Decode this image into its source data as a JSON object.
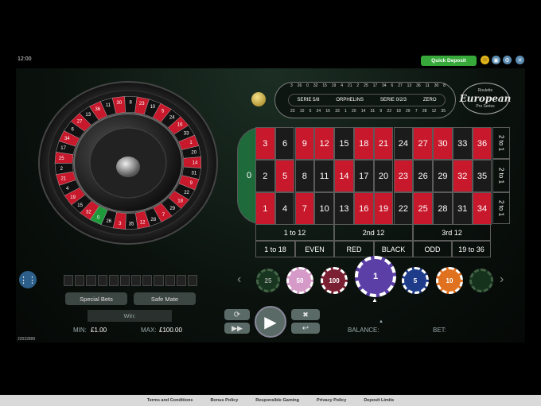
{
  "top": {
    "clock": "12:00",
    "quick_deposit": "Quick Deposit"
  },
  "race": {
    "left_row": [
      "3",
      "26",
      "0",
      "32",
      "15",
      "19",
      "4",
      "21",
      "2",
      "25",
      "17",
      "34",
      "6",
      "27",
      "13",
      "36",
      "11",
      "30",
      "8",
      "23",
      "10",
      "5",
      "24",
      "16",
      "33",
      "1",
      "20",
      "14",
      "31",
      "9",
      "22",
      "18",
      "29",
      "7",
      "28",
      "12",
      "35"
    ],
    "labels": [
      "SERIE 5/8",
      "ORPHELINS",
      "SERIE 0/2/3",
      "ZERO"
    ]
  },
  "logo": {
    "top": "Roulette",
    "main": "European",
    "sub": "Pro Series"
  },
  "table": {
    "zero": "0",
    "row_top": [
      "3",
      "6",
      "9",
      "12",
      "15",
      "18",
      "21",
      "24",
      "27",
      "30",
      "33",
      "36"
    ],
    "row_mid": [
      "2",
      "5",
      "8",
      "11",
      "14",
      "17",
      "20",
      "23",
      "26",
      "29",
      "32",
      "35"
    ],
    "row_bot": [
      "1",
      "4",
      "7",
      "10",
      "13",
      "16",
      "19",
      "22",
      "25",
      "28",
      "31",
      "34"
    ],
    "columns": [
      "2 to 1",
      "2 to 1",
      "2 to 1"
    ],
    "dozens": [
      "1 to 12",
      "2nd 12",
      "3rd 12"
    ],
    "outside": [
      "1 to 18",
      "EVEN",
      "RED",
      "BLACK",
      "ODD",
      "19 to 36"
    ]
  },
  "chips": [
    {
      "value": "25"
    },
    {
      "value": "50"
    },
    {
      "value": "100"
    },
    {
      "value": "1"
    },
    {
      "value": "5"
    },
    {
      "value": "10"
    },
    {
      "value": ""
    }
  ],
  "controls": {
    "special_bets": "Special Bets",
    "safe_mate": "Safe Mate",
    "win_label": "Win:",
    "min_label": "MIN:",
    "min_value": "£1.00",
    "max_label": "MAX:",
    "max_value": "£100.00",
    "balance_label": "BALANCE:",
    "bet_label": "BET:",
    "game_id": "22022890"
  },
  "footer": [
    "Terms and Conditions",
    "Bonus Policy",
    "Responsible Gaming",
    "Privacy Policy",
    "Deposit Limits"
  ],
  "colors": {
    "red": "#c8182b",
    "black": "#1b1b1b",
    "green": "#1f6a3b",
    "accent": "#37a93a"
  }
}
